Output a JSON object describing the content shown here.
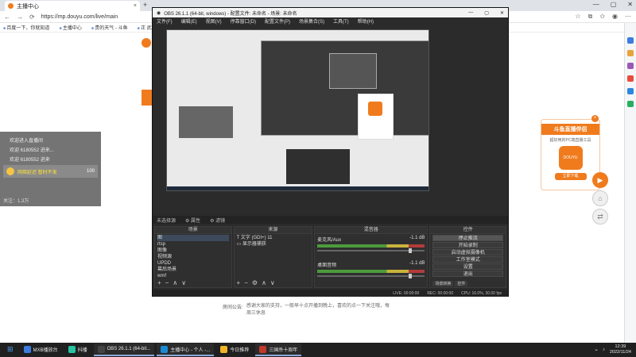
{
  "browser": {
    "tab_title": "主播中心",
    "tab_close": "×",
    "new_tab": "+",
    "window_controls": [
      "—",
      "▢",
      "✕"
    ],
    "nav": [
      "←",
      "→",
      "⟳"
    ],
    "url": "https://mp.douyu.com/live/main",
    "bookmarks": [
      "百度一下，你就知道",
      "主播中心",
      "贵的天气 - 斗鱼",
      "正 武汉精英排"
    ]
  },
  "chat": {
    "lines": [
      "欢迎进入直播间",
      "欢迎 6180552 进来...",
      "欢迎 6180552 进来"
    ],
    "gift_text": "网络延迟 暂时不发",
    "gift_count": "100",
    "followers": "关注：1.3万"
  },
  "announcement": {
    "label": "房间公告:",
    "text": "感谢大家的支持，一般早十点开播到晚上，喜欢的点一下关注哦，每周三休息"
  },
  "promo": {
    "title": "斗鱼直播伴侣",
    "subtitle": "超好用的PC端直播工具",
    "image_label": "DOUYU",
    "button": "立即下载",
    "close": "×"
  },
  "obs": {
    "title": "OBS 26.1.1 (64-bit, windows) - 配置文件: 未命名 - 场景: 未命名",
    "menu": [
      "文件(F)",
      "编辑(E)",
      "视图(V)",
      "停靠窗口(D)",
      "配置文件(P)",
      "场景集合(S)",
      "工具(T)",
      "帮助(H)"
    ],
    "status_strip": [
      "未选择源",
      "⚙ 属性",
      "⚙ 滤镜"
    ],
    "docks": {
      "scenes_title": "场景",
      "scenes": [
        "图",
        "rtsp",
        "图像",
        "视频源",
        "UPDD",
        "幕后场景",
        "wmf"
      ],
      "sources_title": "来源",
      "sources": [
        "文字 (GDI+) 11",
        "显示器捕获"
      ],
      "mixer_title": "混音器",
      "tracks": [
        {
          "name": "麦克风/Aux",
          "db": "-1.1 dB"
        },
        {
          "name": "桌面音频",
          "db": "-1.1 dB"
        }
      ],
      "controls_title": "控件",
      "controls": [
        "停止推流",
        "开始录制",
        "启动虚拟摄像机",
        "工作室模式",
        "设置",
        "退出"
      ],
      "dock_tabs": [
        "场景转换",
        "控件"
      ]
    },
    "statusbar": [
      "LIVE: 00:00:00",
      "REC: 00:00:00",
      "CPU: 16.0%, 30.00 fps"
    ]
  },
  "taskbar": {
    "items": [
      {
        "label": "MXB播放台",
        "color": "#3c7be0"
      },
      {
        "label": "抖播",
        "color": "#26c5a0"
      },
      {
        "label": "OBS 26.1.1 (64-bit...",
        "color": "#444444"
      },
      {
        "label": "主播中心 - 个人 -...",
        "color": "#1a8ad4"
      },
      {
        "label": "今日推荐",
        "color": "#f0b429"
      },
      {
        "label": "三国杀十周年",
        "color": "#c0392b"
      }
    ],
    "time": "12:39",
    "date": "2022/11/24"
  }
}
